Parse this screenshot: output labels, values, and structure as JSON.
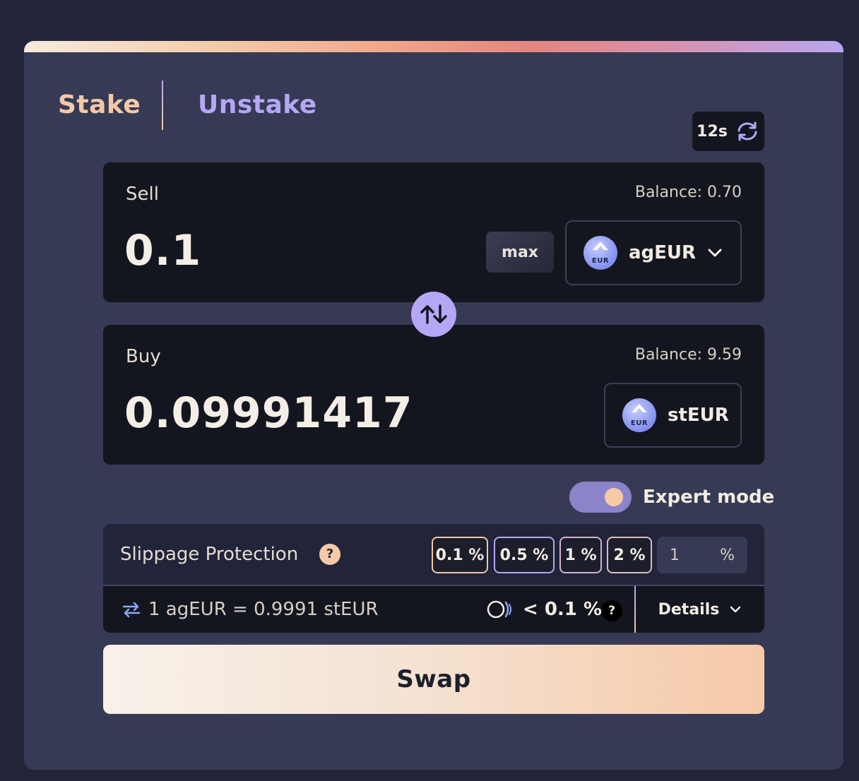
{
  "tabs": {
    "stake": "Stake",
    "unstake": "Unstake"
  },
  "refresh": {
    "label": "12s"
  },
  "sell": {
    "label": "Sell",
    "balance": "Balance: 0.70",
    "amount": "0.1",
    "max_label": "max",
    "token": "agEUR",
    "token_icon_text": "EUR"
  },
  "buy": {
    "label": "Buy",
    "balance": "Balance: 9.59",
    "amount": "0.09991417",
    "token": "stEUR",
    "token_icon_text": "EUR"
  },
  "expert_mode": {
    "label": "Expert mode",
    "enabled": true
  },
  "slippage": {
    "label": "Slippage Protection",
    "help": "?",
    "options": [
      "0.1 %",
      "0.5 %",
      "1 %",
      "2 %"
    ],
    "custom_value": "1",
    "custom_unit": "%"
  },
  "rate": {
    "text": "1 agEUR = 0.9991 stEUR",
    "price_impact": "< 0.1 %",
    "help": "?",
    "details_label": "Details"
  },
  "swap_button": {
    "label": "Swap"
  },
  "colors": {
    "background": "#22253a",
    "card": "#363a54",
    "panel": "#14161f",
    "accent_orange": "#f4c9a6",
    "accent_purple": "#b5a7f5"
  }
}
